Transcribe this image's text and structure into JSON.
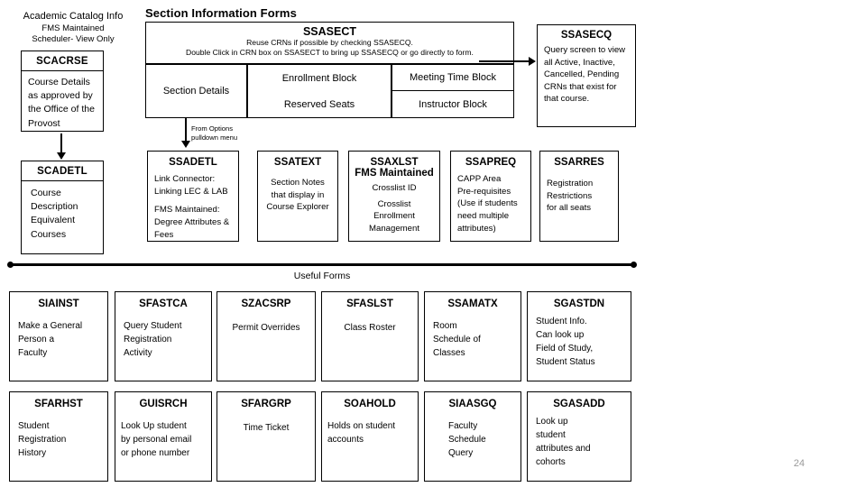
{
  "slide": {
    "page_number": "24",
    "section_header": "Section Information Forms",
    "useful_forms_label": "Useful Forms"
  },
  "catalog": {
    "heading": "Academic Catalog Info",
    "sub1": "FMS Maintained",
    "sub2": "Scheduler- View Only",
    "scacrse": {
      "title": "SCACRSE",
      "body": "Course Details as approved by the Office of the Provost"
    },
    "scadetl": {
      "title": "SCADETL",
      "lines": [
        "Course",
        "Description",
        "Equivalent",
        "Courses"
      ]
    }
  },
  "ssasect": {
    "title": "SSASECT",
    "note1": "Reuse CRNs if possible by checking SSASECQ.",
    "note2": "Double Click in CRN box on SSASECT to bring up SSASECQ or go directly to form.",
    "col1": "Section Details",
    "col2_line1": "Enrollment Block",
    "col2_line2": "Reserved Seats",
    "col3_line1": "Meeting Time Block",
    "col3_line2": "Instructor Block"
  },
  "ssasecq": {
    "title": "SSASECQ",
    "body": "Query screen to view all Active, Inactive, Cancelled, Pending CRNs that exist for that course."
  },
  "connectors": {
    "options_menu_label_l1": "From Options",
    "options_menu_label_l2": "pulldown menu"
  },
  "detail_forms": [
    {
      "id": "ssadetl",
      "title": "SSADETL",
      "body_1": "Link Connector:",
      "body_2": "Linking LEC & LAB",
      "body_3": "FMS Maintained:",
      "body_4": "Degree Attributes &",
      "body_5": "Fees"
    },
    {
      "id": "ssatext",
      "title": "SSATEXT",
      "body_1": "Section Notes",
      "body_2": "that display in",
      "body_3": "Course Explorer"
    },
    {
      "id": "ssaxlst",
      "title": "SSAXLST",
      "subtitle": "FMS Maintained",
      "body_1": "Crosslist ID",
      "body_2": "Crosslist",
      "body_3": "Enrollment",
      "body_4": "Management"
    },
    {
      "id": "ssapreq",
      "title": "SSAPREQ",
      "body_1": "CAPP Area",
      "body_2": "Pre-requisites",
      "body_3": "(Use if students",
      "body_4": "need multiple",
      "body_5": "attributes)"
    },
    {
      "id": "ssarres",
      "title": "SSARRES",
      "body_1": "Registration",
      "body_2": "Restrictions",
      "body_3": "for all seats"
    }
  ],
  "useful_forms": {
    "row1": [
      {
        "title": "SIAINST",
        "body_1": "Make a General",
        "body_2": "Person a",
        "body_3": "Faculty"
      },
      {
        "title": "SFASTCA",
        "body_1": "Query Student",
        "body_2": "Registration",
        "body_3": "Activity"
      },
      {
        "title": "SZACSRP",
        "body_1": "Permit Overrides",
        "body_2": "",
        "body_3": ""
      },
      {
        "title": "SFASLST",
        "body_1": "Class Roster",
        "body_2": "",
        "body_3": ""
      },
      {
        "title": "SSAMATX",
        "body_1": "Room",
        "body_2": "Schedule of",
        "body_3": "Classes"
      },
      {
        "title": "SGASTDN",
        "body_1": "Student Info.",
        "body_2": "Can look up",
        "body_3": "Field of Study,",
        "body_4": "Student Status"
      }
    ],
    "row2": [
      {
        "title": "SFARHST",
        "body_1": "Student",
        "body_2": "Registration",
        "body_3": "History"
      },
      {
        "title": "GUISRCH",
        "body_1": "Look Up student",
        "body_2": "by personal email",
        "body_3": "or phone number"
      },
      {
        "title": "SFARGRP",
        "body_1": "Time Ticket",
        "body_2": "",
        "body_3": ""
      },
      {
        "title": "SOAHOLD",
        "body_1": "Holds on student",
        "body_2": "accounts",
        "body_3": ""
      },
      {
        "title": "SIAASGQ",
        "body_1": "Faculty",
        "body_2": "Schedule",
        "body_3": "Query"
      },
      {
        "title": "SGASADD",
        "body_1": "Look up",
        "body_2": "student",
        "body_3": "attributes and",
        "body_4": "cohorts"
      }
    ]
  },
  "colors": {
    "stroke": "#000000",
    "background": "#ffffff",
    "page_number": "#9a9a9a"
  }
}
